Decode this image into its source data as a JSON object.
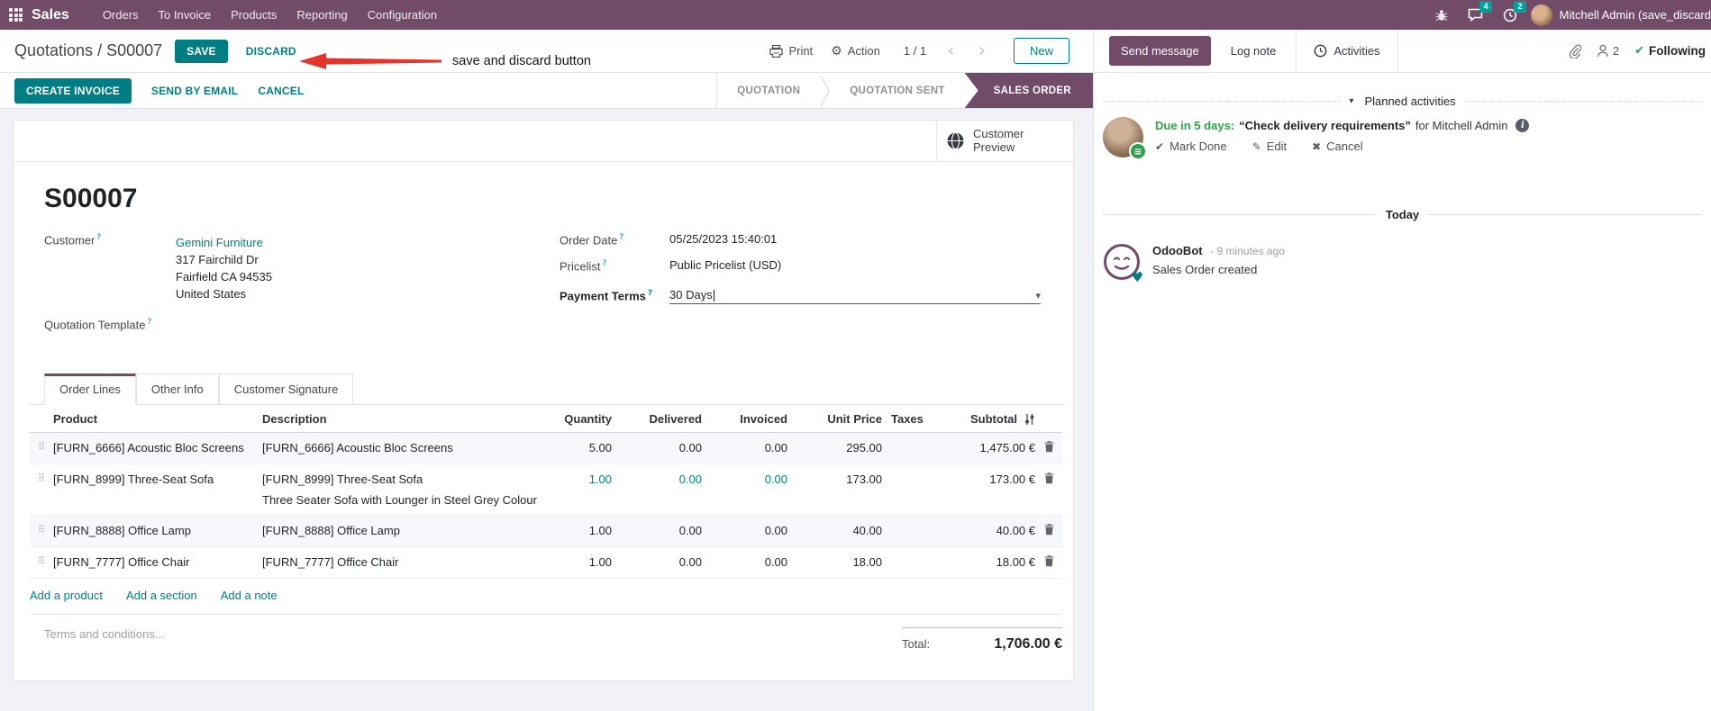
{
  "colors": {
    "brand_purple": "#714B67",
    "accent_teal": "#017e84",
    "badge_teal": "#00A09D",
    "success_green": "#28a745",
    "annotation_red": "#e4342c"
  },
  "icons": {
    "gear": "⚙",
    "caret_down": "▾",
    "chevron_left": "‹",
    "chevron_right": "›",
    "drag_handle": "⠿",
    "check": "✔",
    "pencil": "✎",
    "cross": "✖",
    "list": "≡",
    "heart": "♥",
    "info": "i"
  },
  "nav": {
    "app_name": "Sales",
    "menus": [
      "Orders",
      "To Invoice",
      "Products",
      "Reporting",
      "Configuration"
    ],
    "messages_badge": "4",
    "activities_badge": "2",
    "user_name": "Mitchell Admin (save_discard"
  },
  "control_panel": {
    "breadcrumb_parent": "Quotations",
    "breadcrumb_sep": " / ",
    "breadcrumb_current": "S00007",
    "save": "SAVE",
    "discard": "DISCARD",
    "annotation": "save and discard button",
    "print": "Print",
    "action": "Action",
    "pager": "1 / 1",
    "new": "New"
  },
  "action_buttons": {
    "create_invoice": "CREATE INVOICE",
    "send_by_email": "SEND BY EMAIL",
    "cancel": "CANCEL"
  },
  "statusbar": {
    "quotation": "QUOTATION",
    "quotation_sent": "QUOTATION SENT",
    "sales_order": "SALES ORDER"
  },
  "form": {
    "help_marker": "?",
    "customer_preview_line1": "Customer",
    "customer_preview_line2": "Preview",
    "title": "S00007",
    "customer_label": "Customer",
    "customer_value": "Gemini Furniture",
    "address_line1": "317 Fairchild Dr",
    "address_line2": "Fairfield CA 94535",
    "address_line3": "United States",
    "quotation_template_label": "Quotation Template",
    "order_date_label": "Order Date",
    "order_date_value": "05/25/2023 15:40:01",
    "pricelist_label": "Pricelist",
    "pricelist_value": "Public Pricelist (USD)",
    "payment_terms_label": "Payment Terms",
    "payment_terms_value": "30 Days"
  },
  "tabs": {
    "order_lines": "Order Lines",
    "other_info": "Other Info",
    "customer_signature": "Customer Signature"
  },
  "order_lines": {
    "columns": {
      "product": "Product",
      "description": "Description",
      "quantity": "Quantity",
      "delivered": "Delivered",
      "invoiced": "Invoiced",
      "unit_price": "Unit Price",
      "taxes": "Taxes",
      "subtotal": "Subtotal"
    },
    "rows": [
      {
        "product": "[FURN_6666] Acoustic Bloc Screens",
        "description": "[FURN_6666] Acoustic Bloc Screens",
        "description2": "",
        "quantity": "5.00",
        "delivered": "0.00",
        "invoiced": "0.00",
        "unit_price": "295.00",
        "taxes": "",
        "subtotal": "1,475.00 €"
      },
      {
        "product": "[FURN_8999] Three-Seat Sofa",
        "description": "[FURN_8999] Three-Seat Sofa",
        "description2": "Three Seater Sofa with Lounger in Steel Grey Colour",
        "quantity": "1.00",
        "delivered": "0.00",
        "invoiced": "0.00",
        "unit_price": "173.00",
        "taxes": "",
        "subtotal": "173.00 €"
      },
      {
        "product": "[FURN_8888] Office Lamp",
        "description": "[FURN_8888] Office Lamp",
        "description2": "",
        "quantity": "1.00",
        "delivered": "0.00",
        "invoiced": "0.00",
        "unit_price": "40.00",
        "taxes": "",
        "subtotal": "40.00 €"
      },
      {
        "product": "[FURN_7777] Office Chair",
        "description": "[FURN_7777] Office Chair",
        "description2": "",
        "quantity": "1.00",
        "delivered": "0.00",
        "invoiced": "0.00",
        "unit_price": "18.00",
        "taxes": "",
        "subtotal": "18.00 €"
      }
    ],
    "add_product": "Add a product",
    "add_section": "Add a section",
    "add_note": "Add a note",
    "terms_placeholder": "Terms and conditions...",
    "total_label": "Total:",
    "total_value": "1,706.00 €"
  },
  "chatter": {
    "send_message": "Send message",
    "log_note": "Log note",
    "activities": "Activities",
    "followers_count": "2",
    "following": "Following",
    "planned_header": "Planned activities",
    "activity": {
      "due": "Due in 5 days:",
      "summary": "“Check delivery requirements”",
      "assignee": "for Mitchell Admin",
      "mark_done": "Mark Done",
      "edit": "Edit",
      "cancel": "Cancel"
    },
    "today": "Today",
    "message": {
      "author": "OdooBot",
      "time": "- 9 minutes ago",
      "body": "Sales Order created"
    }
  }
}
